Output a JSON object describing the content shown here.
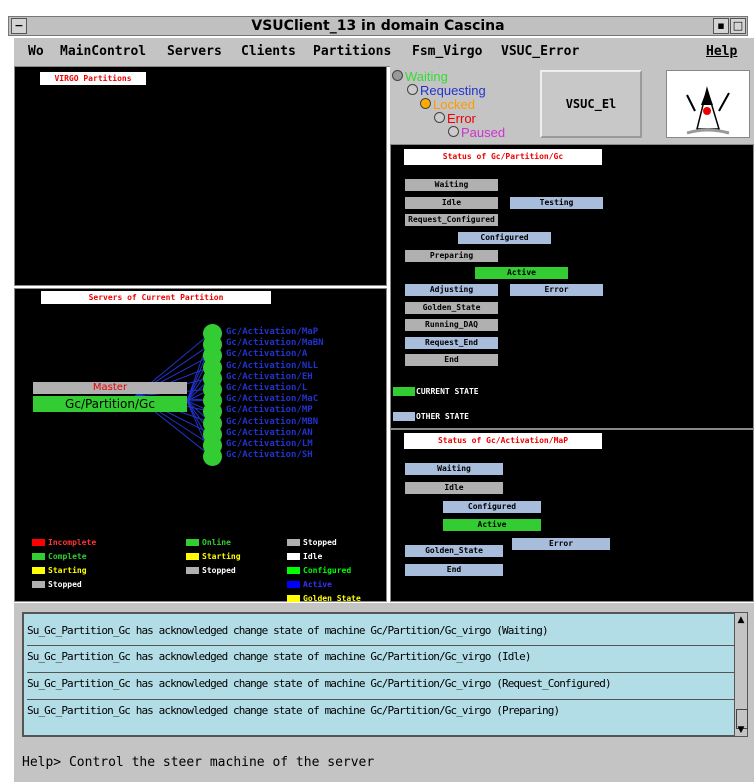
{
  "window": {
    "title": "VSUClient_13 in domain Cascina"
  },
  "menu": {
    "items": [
      "Wo",
      "MainControl",
      "Servers",
      "Clients",
      "Partitions",
      "Fsm_Virgo",
      "VSUC_Error"
    ],
    "help": "Help"
  },
  "partitions_panel": {
    "label": "VIRGO Partitions"
  },
  "states_legend": {
    "waiting": "Waiting",
    "requesting": "Requesting",
    "locked": "Locked",
    "error": "Error",
    "paused": "Paused"
  },
  "vsuc_button": "VSUC_El",
  "servers_panel": {
    "label": "Servers of Current Partition",
    "master": "Master",
    "partition": "Gc/Partition/Gc",
    "servers": [
      "Gc/Activation/MaP",
      "Gc/Activation/MaBN",
      "Gc/Activation/A",
      "Gc/Activation/NLL",
      "Gc/Activation/EH",
      "Gc/Activation/L",
      "Gc/Activation/MaC",
      "Gc/Activation/MP",
      "Gc/Activation/MBN",
      "Gc/Activation/AN",
      "Gc/Activation/LM",
      "Gc/Activation/SH"
    ]
  },
  "legend": {
    "col1": [
      {
        "text": "Incomplete",
        "color": "#ff0000"
      },
      {
        "text": "Complete",
        "color": "#33cc33"
      },
      {
        "text": "Starting",
        "color": "#ffff00"
      },
      {
        "text": "Stopped",
        "color": "#b0b0b0"
      }
    ],
    "col2": [
      {
        "text": "Online",
        "color": "#33cc33"
      },
      {
        "text": "Starting",
        "color": "#ffff00"
      },
      {
        "text": "Stopped",
        "color": "#b0b0b0"
      }
    ],
    "col3": [
      {
        "text": "Stopped",
        "color": "#b0b0b0"
      },
      {
        "text": "Idle",
        "color": "#ffffff"
      },
      {
        "text": "Configured",
        "color": "#00ff00"
      },
      {
        "text": "Active",
        "color": "#0000ff"
      },
      {
        "text": "Golden State",
        "color": "#ffff00"
      }
    ]
  },
  "status_gc": {
    "label": "Status of Gc/Partition/Gc",
    "states": {
      "waiting": "Waiting",
      "idle": "Idle",
      "testing": "Testing",
      "request_configured": "Request_Configured",
      "configured": "Configured",
      "preparing": "Preparing",
      "active": "Active",
      "adjusting": "Adjusting",
      "error": "Error",
      "golden_state": "Golden_State",
      "running_daq": "Running_DAQ",
      "request_end": "Request_End",
      "end": "End"
    },
    "current_state": "CURRENT STATE",
    "other_state": "OTHER STATE"
  },
  "status_map": {
    "label": "Status of Gc/Activation/MaP",
    "states": {
      "waiting": "Waiting",
      "idle": "Idle",
      "configured": "Configured",
      "active": "Active",
      "error": "Error",
      "golden_state": "Golden_State",
      "end": "End"
    }
  },
  "log": [
    "Su_Gc_Partition_Gc has acknowledged change state of machine Gc/Partition/Gc_virgo (Waiting)",
    "Su_Gc_Partition_Gc has acknowledged change state of machine Gc/Partition/Gc_virgo (Idle)",
    "Su_Gc_Partition_Gc has acknowledged change state of machine Gc/Partition/Gc_virgo (Request_Configured)",
    "Su_Gc_Partition_Gc has acknowledged change state of machine Gc/Partition/Gc_virgo (Preparing)"
  ],
  "help_text": "Help> Control the steer machine of the server"
}
